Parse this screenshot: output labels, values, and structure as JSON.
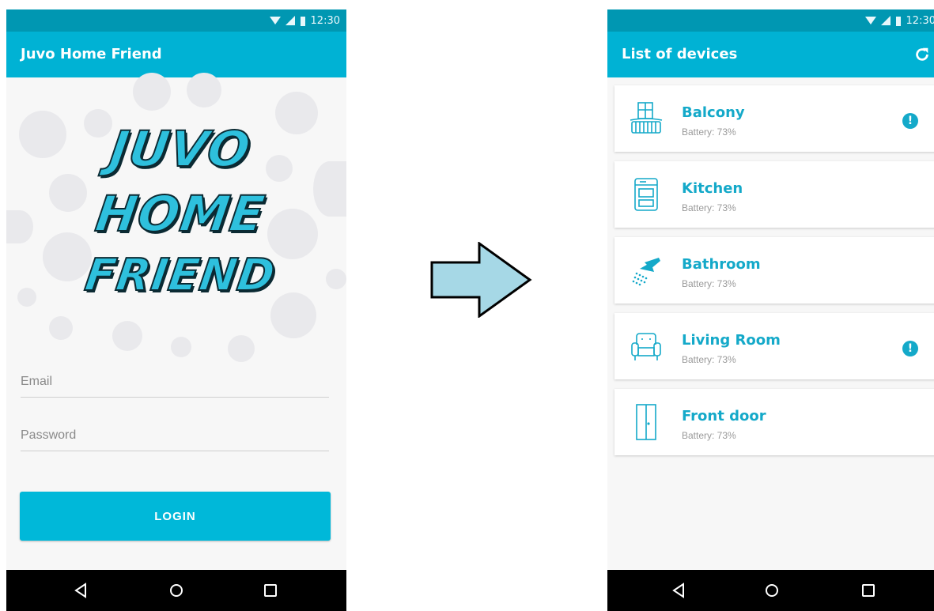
{
  "status": {
    "time": "12:30"
  },
  "login_screen": {
    "app_title": "Juvo Home Friend",
    "logo_lines": [
      "JUVO",
      "HOME",
      "FRIEND"
    ],
    "email_placeholder": "Email",
    "password_placeholder": "Password",
    "login_label": "LOGIN"
  },
  "devices_screen": {
    "title": "List of devices",
    "refresh_icon": "refresh-icon",
    "devices": [
      {
        "name": "Balcony",
        "battery": "Battery: 73%",
        "icon": "balcony-icon",
        "alert": true
      },
      {
        "name": "Kitchen",
        "battery": "Battery: 73%",
        "icon": "stove-icon",
        "alert": false
      },
      {
        "name": "Bathroom",
        "battery": "Battery: 73%",
        "icon": "shower-icon",
        "alert": false
      },
      {
        "name": "Living Room",
        "battery": "Battery: 73%",
        "icon": "armchair-icon",
        "alert": true
      },
      {
        "name": "Front door",
        "battery": "Battery: 73%",
        "icon": "door-icon",
        "alert": false
      }
    ]
  },
  "colors": {
    "primary": "#00b2d4",
    "status_bar": "#0097b2",
    "accent": "#14a9c9",
    "arrow_fill": "#a6d8e6"
  },
  "nav": {
    "icons": [
      "back-icon",
      "home-icon",
      "recents-icon"
    ]
  }
}
